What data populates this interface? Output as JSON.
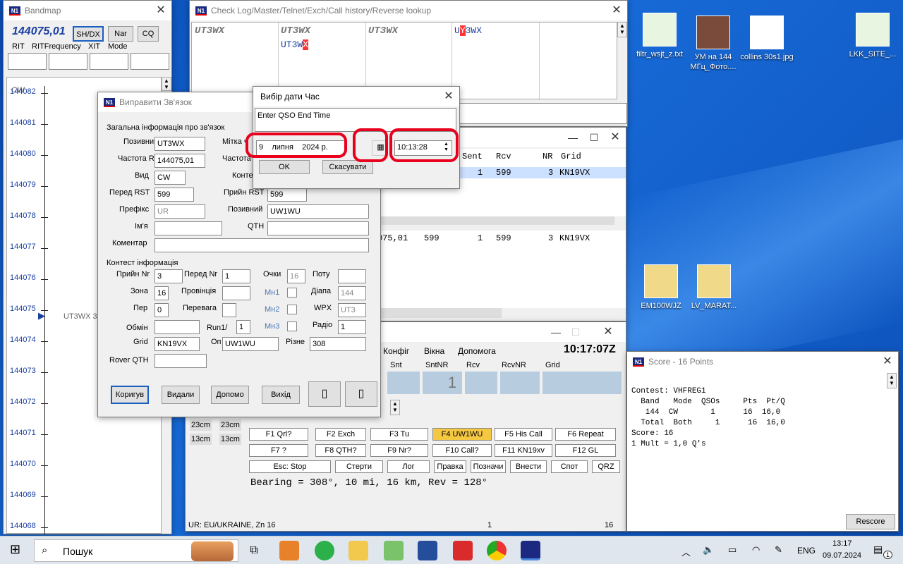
{
  "desktop": {
    "icons": [
      {
        "label": "filtr_wsjt_z.txt"
      },
      {
        "label": "УМ на 144 МГц_Фото...."
      },
      {
        "label": "collins 30s1.jpg"
      },
      {
        "label": "LKK_SITE_..."
      },
      {
        "label": "EM100WJZ"
      },
      {
        "label": "LV_MARAT..."
      }
    ]
  },
  "bandmap": {
    "title": "Bandmap",
    "freq": "144075,01",
    "buttons": [
      "SH/DX",
      "Nar",
      "CQ"
    ],
    "headers": [
      "RIT",
      "RITFrequency",
      "XIT",
      "Mode"
    ],
    "mode_label": "CW",
    "ticks": [
      "144082",
      "144081",
      "144080",
      "144079",
      "144078",
      "144077",
      "144076",
      "144075",
      "144074",
      "144073",
      "144072",
      "144071",
      "144070",
      "144069",
      "144068"
    ],
    "spot": "UT3WX 30"
  },
  "checklog": {
    "title": "Check Log/Master/Telnet/Exch/Call history/Reverse lookup",
    "cells": [
      "UT3WX",
      "UT3WX",
      "UT3WX",
      "UT3WX"
    ],
    "cell_row2_a": "UT3W",
    "cell_row2_b": "X",
    "cell4_a": "U",
    "cell4_b": "Y",
    "cell4_c": "3WX"
  },
  "edit": {
    "title": "Виправити Зв'язок",
    "general": "Загальна інформація про зв'язок",
    "f": {
      "call_l": "Позивний",
      "call": "UT3WX",
      "mark_l": "Мітка ч",
      "rx_l": "Частота Rx",
      "rx": "144075,01",
      "tx_l": "Частота",
      "mode_l": "Вид",
      "mode": "CW",
      "cont_l": "Конте",
      "srst_l": "Перед RST",
      "srst": "599",
      "rrst_l": "Прийн RST",
      "rrst": "599",
      "pfx_l": "Префікс",
      "pfx": "UR",
      "op_l": "Позивний",
      "op": "UW1WU",
      "name_l": "Ім'я",
      "qth_l": "QTH",
      "cmt_l": "Коментар"
    },
    "contest": "Контест інформація",
    "c": {
      "rnr_l": "Прийн Nr",
      "rnr": "3",
      "snr_l": "Перед Nr",
      "snr": "1",
      "pts_l": "Очки",
      "pts": "16",
      "potu_l": "Поту",
      "zone_l": "Зона",
      "zone": "16",
      "prov_l": "Провінція",
      "m1_l": "Мн1",
      "range_l": "Діапа",
      "range": "144",
      "per_l": "Пер",
      "per": "0",
      "prev_l": "Перевага",
      "m2_l": "Мн2",
      "wpx_l": "WPX",
      "wpx": "UT3",
      "obm_l": "Обмін",
      "run_l": "Run1/",
      "run": "1",
      "m3_l": "Мн3",
      "radio_l": "Радіо",
      "radio": "1",
      "grid_l": "Grid",
      "grid": "KN19VX",
      "opr_l": "Оп",
      "opr": "UW1WU",
      "misc_l": "Різне",
      "misc": "308",
      "rqth_l": "Rover QTH"
    },
    "buttons": [
      "Коригув",
      "Видали",
      "Допомо",
      "Вихід"
    ]
  },
  "dt": {
    "title": "Вибір дати Час",
    "prompt": "Enter QSO End Time",
    "day": "9",
    "month": "липня",
    "year": "2024 р.",
    "time": "10:13:28",
    "ok": "OK",
    "cancel": "Скасувати"
  },
  "log": {
    "headers": [
      "Sent",
      "Rcv",
      "NR",
      "Grid"
    ],
    "row": [
      "1",
      "599",
      "3",
      "KN19VX"
    ],
    "row2": [
      "075,01",
      "599",
      "1",
      "599",
      "3",
      "KN19VX"
    ]
  },
  "entry": {
    "clock": "10:17:07Z",
    "menu": [
      "Конфіг",
      "Вікна",
      "Допомога"
    ],
    "cols": [
      "Snt",
      "SntNR",
      "Rcv",
      "RcvNR",
      "Grid"
    ],
    "sntnr": "1",
    "bands": [
      "23cm",
      "23cm",
      "13cm",
      "13cm"
    ],
    "fkeys": [
      [
        "F1 Qrl?",
        "F2 Exch",
        "F3 Tu",
        "F4 UW1WU",
        "F5 His Call",
        "F6 Repeat"
      ],
      [
        "F7 ?",
        "F8 QTH?",
        "F9 Nr?",
        "F10 Call?",
        "F11 KN19xv",
        "F12 GL"
      ],
      [
        "Esc: Stop",
        "Стерти",
        "Лог",
        "Правка",
        "Позначи",
        "Внести",
        "Спот",
        "QRZ"
      ]
    ],
    "bearing": "Bearing = 308°, 10  mi, 16 km, Rev = 128°",
    "status": [
      "UR: EU/UKRAINE, Zn 16",
      "1",
      "16"
    ]
  },
  "score": {
    "title": "Score - 16 Points",
    "lines": [
      "Contest: VHFREG1",
      "  Band   Mode  QSOs     Pts  Pt/Q",
      "   144  CW       1      16  16,0",
      "  Total  Both     1      16  16,0",
      "Score: 16",
      "1 Mult = 1,0 Q's"
    ],
    "rescore": "Rescore"
  },
  "taskbar": {
    "search": "Пошук",
    "lang": "ENG",
    "time": "13:17",
    "date": "09.07.2024",
    "badge": "1"
  },
  "colors": {
    "accent": "#0a4db5",
    "highlight": "#f5c842",
    "selected": "#cce0ff",
    "ring": "#e8001c"
  }
}
